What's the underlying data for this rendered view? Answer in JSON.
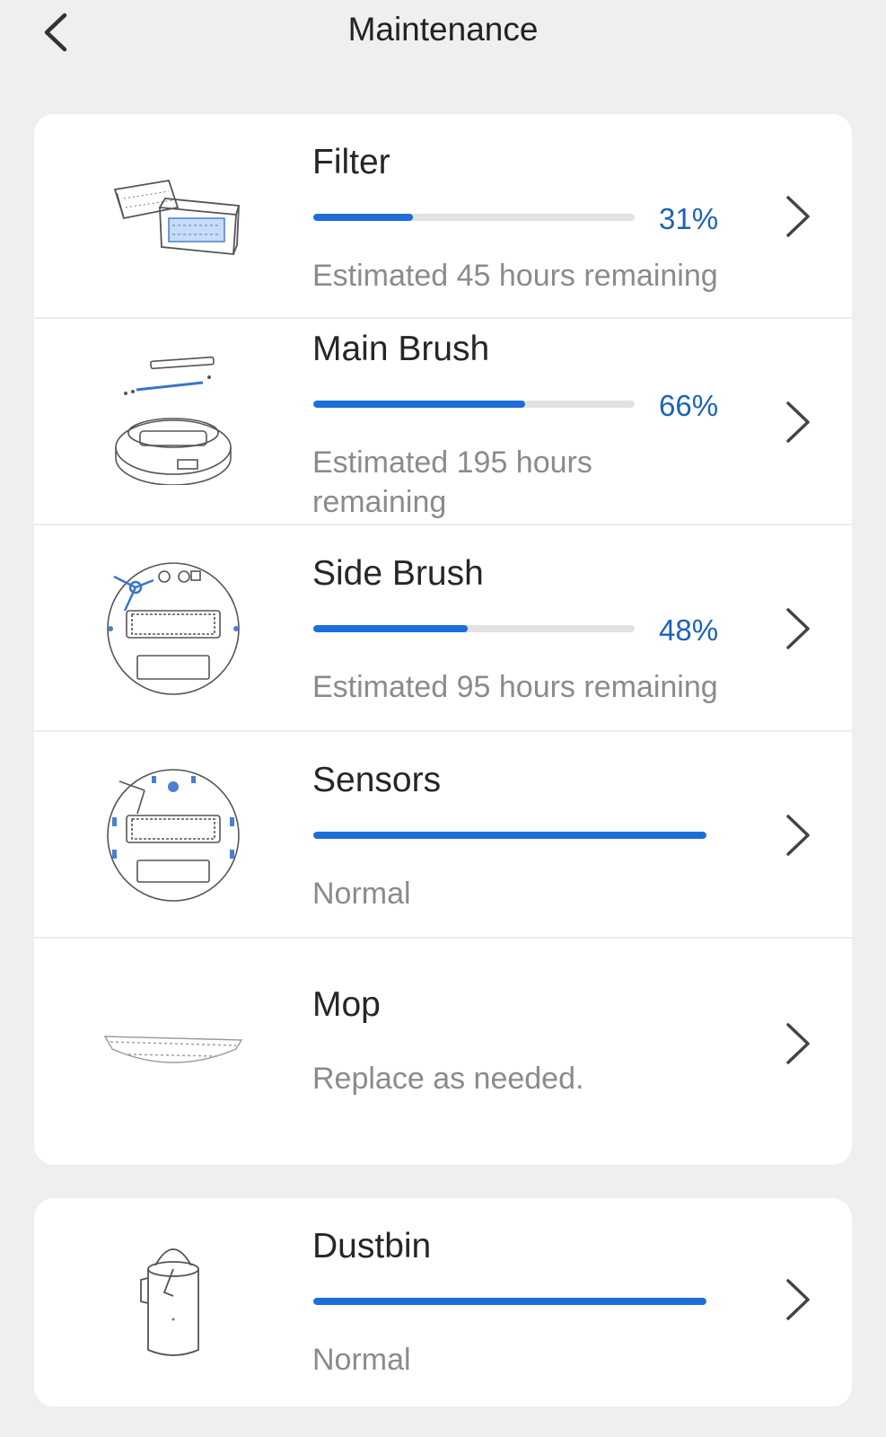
{
  "header": {
    "title": "Maintenance",
    "back_icon": "chevron-left-icon"
  },
  "colors": {
    "accent": "#1d6ed8",
    "percent_text": "#1a63b9",
    "track": "#e2e2e2",
    "subtext": "#8b8b8b",
    "background": "#efefef",
    "card": "#ffffff"
  },
  "items": [
    {
      "title": "Filter",
      "progress": 31,
      "percent_label": "31%",
      "status": "Estimated 45 hours remaining",
      "icon": "filter-icon"
    },
    {
      "title": "Main Brush",
      "progress": 66,
      "percent_label": "66%",
      "status": "Estimated 195 hours remaining",
      "icon": "main-brush-icon"
    },
    {
      "title": "Side Brush",
      "progress": 48,
      "percent_label": "48%",
      "status": "Estimated 95 hours remaining",
      "icon": "side-brush-icon"
    },
    {
      "title": "Sensors",
      "progress": 100,
      "status": "Normal",
      "icon": "sensors-icon"
    },
    {
      "title": "Mop",
      "status": "Replace as needed.",
      "icon": "mop-icon"
    }
  ],
  "dustbin": {
    "title": "Dustbin",
    "progress": 100,
    "status": "Normal",
    "icon": "dustbin-icon"
  }
}
